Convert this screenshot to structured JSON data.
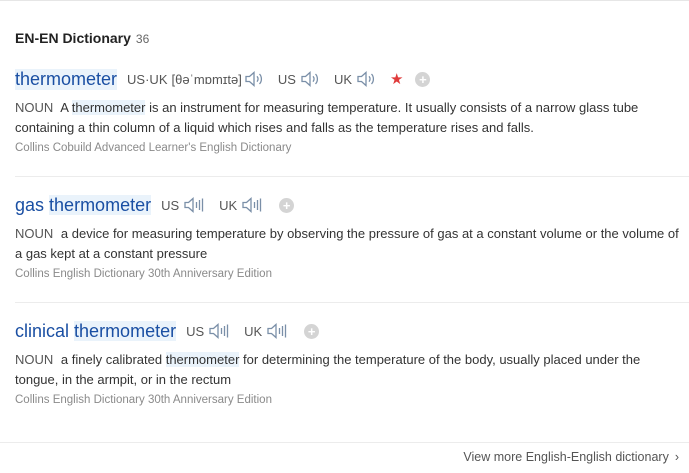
{
  "dictionary": {
    "title": "EN-EN Dictionary",
    "count": "36"
  },
  "entries": [
    {
      "word": "thermometer",
      "pron": {
        "usuk_label": "US·UK",
        "phonetic": "[θəˈmɒmɪtə]",
        "us_label": "US",
        "uk_label": "UK"
      },
      "definition": {
        "pos": "NOUN",
        "before": "A",
        "highlight": "thermometer",
        "after": "is an instrument for measuring temperature. It usually consists of a narrow glass tube containing a thin column of a liquid which rises and falls as the temperature rises and falls."
      },
      "source": "Collins Cobuild Advanced Learner's English Dictionary"
    },
    {
      "word_prefix": "gas",
      "word_highlight": "thermometer",
      "pron": {
        "us_label": "US",
        "uk_label": "UK"
      },
      "definition": {
        "pos": "NOUN",
        "text": "a device for measuring temperature by observing the pressure of gas at a constant volume or the volume of a gas kept at a constant pressure"
      },
      "source": "Collins English Dictionary 30th Anniversary Edition"
    },
    {
      "word_prefix": "clinical",
      "word_highlight": "thermometer",
      "pron": {
        "us_label": "US",
        "uk_label": "UK"
      },
      "definition": {
        "pos": "NOUN",
        "before": "a finely calibrated",
        "highlight": "thermometer",
        "after": "for determining the temperature of the body, usually placed under the tongue, in the armpit, or in the rectum"
      },
      "source": "Collins English Dictionary 30th Anniversary Edition"
    }
  ],
  "icons": {
    "plus": "+",
    "star": "★",
    "chevron": "›"
  },
  "colors": {
    "word": "#1a4fa3",
    "highlight": "#eaf3fb",
    "star": "#e03b3b"
  },
  "footer": {
    "more_link": "View more English-English dictionary"
  }
}
